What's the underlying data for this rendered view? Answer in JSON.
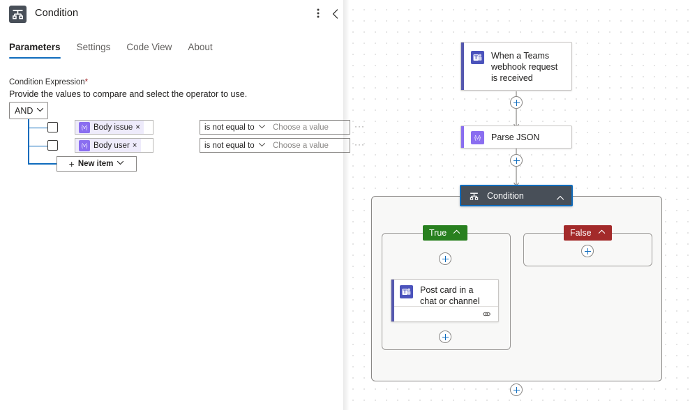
{
  "panel": {
    "title": "Condition",
    "icon": "condition-icon",
    "more_icon": "more-vertical-icon",
    "collapse_icon": "chevron-left-icon",
    "tabs": [
      {
        "label": "Parameters",
        "active": true
      },
      {
        "label": "Settings",
        "active": false
      },
      {
        "label": "Code View",
        "active": false
      },
      {
        "label": "About",
        "active": false
      }
    ],
    "field": {
      "label": "Condition Expression",
      "required_mark": "*",
      "help": "Provide the values to compare and select the operator to use."
    },
    "logic_operator": {
      "value": "AND",
      "chevron": "chevron-down-icon"
    },
    "rows": [
      {
        "checked": false,
        "token": {
          "icon": "expression-icon",
          "glyph": "{v}",
          "label": "Body issue",
          "remove": "×"
        },
        "operator": "is not equal to",
        "value": "",
        "value_placeholder": "Choose a value",
        "more": "···"
      },
      {
        "checked": false,
        "token": {
          "icon": "expression-icon",
          "glyph": "{v}",
          "label": "Body user",
          "remove": "×"
        },
        "operator": "is not equal to",
        "value": "",
        "value_placeholder": "Choose a value",
        "more": "···"
      }
    ],
    "new_item": {
      "plus": "+",
      "label": "New item",
      "chevron": "chevron-down-icon"
    }
  },
  "canvas": {
    "nodes": {
      "trigger": {
        "title": "When a Teams webhook request is received",
        "icon": "teams-icon",
        "accent": "#5558af"
      },
      "parse": {
        "title": "Parse JSON",
        "icon": "expression-icon",
        "glyph": "{v}",
        "accent": "#8a6ef0"
      },
      "condition": {
        "title": "Condition",
        "icon": "condition-icon",
        "chevron": "chevron-up-icon",
        "selected": true
      },
      "post_card": {
        "title": "Post card in a chat or channel",
        "icon": "teams-icon",
        "accent": "#5558af",
        "footer_icon": "link-icon"
      }
    },
    "branches": {
      "true": {
        "label": "True",
        "chevron": "chevron-up-icon",
        "color": "#28801f"
      },
      "false": {
        "label": "False",
        "chevron": "chevron-up-icon",
        "color": "#a32a2a"
      }
    },
    "add_buttons": [
      "add-step-after-trigger",
      "add-step-after-parse-json",
      "add-step-true-branch-top",
      "add-step-true-branch-bottom",
      "add-step-false-branch",
      "add-step-after-condition"
    ]
  },
  "colors": {
    "accent": "#0f6cbd",
    "true_green": "#28801f",
    "false_red": "#a32a2a",
    "condition_header": "#484f58",
    "token_purple": "#8a6ef0",
    "teams_indigo": "#5558af"
  }
}
